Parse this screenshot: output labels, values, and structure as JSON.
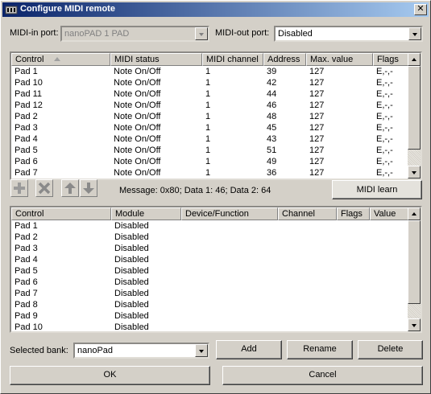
{
  "window": {
    "title": "Configure MIDI remote"
  },
  "midi_in": {
    "label": "MIDI-in port:",
    "value": "nanoPAD 1 PAD"
  },
  "midi_out": {
    "label": "MIDI-out port:",
    "value": "Disabled"
  },
  "controls_table": {
    "columns": [
      "Control",
      "MIDI status",
      "MIDI channel",
      "Address",
      "Max. value",
      "Flags"
    ],
    "rows": [
      [
        "Pad 1",
        "Note On/Off",
        "1",
        "39",
        "127",
        "E,-,-"
      ],
      [
        "Pad 10",
        "Note On/Off",
        "1",
        "42",
        "127",
        "E,-,-"
      ],
      [
        "Pad 11",
        "Note On/Off",
        "1",
        "44",
        "127",
        "E,-,-"
      ],
      [
        "Pad 12",
        "Note On/Off",
        "1",
        "46",
        "127",
        "E,-,-"
      ],
      [
        "Pad 2",
        "Note On/Off",
        "1",
        "48",
        "127",
        "E,-,-"
      ],
      [
        "Pad 3",
        "Note On/Off",
        "1",
        "45",
        "127",
        "E,-,-"
      ],
      [
        "Pad 4",
        "Note On/Off",
        "1",
        "43",
        "127",
        "E,-,-"
      ],
      [
        "Pad 5",
        "Note On/Off",
        "1",
        "51",
        "127",
        "E,-,-"
      ],
      [
        "Pad 6",
        "Note On/Off",
        "1",
        "49",
        "127",
        "E,-,-"
      ],
      [
        "Pad 7",
        "Note On/Off",
        "1",
        "36",
        "127",
        "E,-,-"
      ]
    ]
  },
  "toolbar": {
    "add_icon": "plus-icon",
    "remove_icon": "x-icon",
    "up_icon": "arrow-up-icon",
    "down_icon": "arrow-down-icon"
  },
  "message": "Message: 0x80; Data 1: 46; Data 2: 64",
  "midi_learn_label": "MIDI learn",
  "mapping_table": {
    "columns": [
      "Control",
      "Module",
      "Device/Function",
      "Channel",
      "Flags",
      "Value"
    ],
    "rows": [
      [
        "Pad 1",
        "Disabled",
        "",
        "",
        "",
        ""
      ],
      [
        "Pad 2",
        "Disabled",
        "",
        "",
        "",
        ""
      ],
      [
        "Pad 3",
        "Disabled",
        "",
        "",
        "",
        ""
      ],
      [
        "Pad 4",
        "Disabled",
        "",
        "",
        "",
        ""
      ],
      [
        "Pad 5",
        "Disabled",
        "",
        "",
        "",
        ""
      ],
      [
        "Pad 6",
        "Disabled",
        "",
        "",
        "",
        ""
      ],
      [
        "Pad 7",
        "Disabled",
        "",
        "",
        "",
        ""
      ],
      [
        "Pad 8",
        "Disabled",
        "",
        "",
        "",
        ""
      ],
      [
        "Pad 9",
        "Disabled",
        "",
        "",
        "",
        ""
      ],
      [
        "Pad 10",
        "Disabled",
        "",
        "",
        "",
        ""
      ]
    ]
  },
  "bank": {
    "label": "Selected bank:",
    "value": "nanoPad"
  },
  "buttons": {
    "add": "Add",
    "rename": "Rename",
    "delete": "Delete",
    "ok": "OK",
    "cancel": "Cancel"
  }
}
